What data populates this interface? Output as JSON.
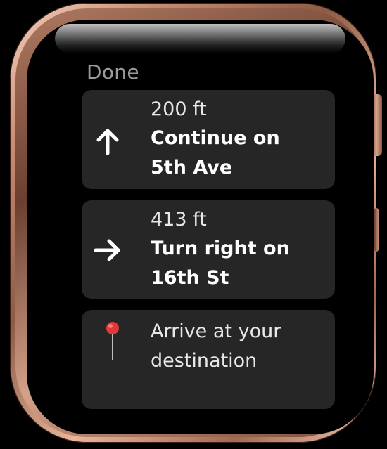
{
  "header": {
    "done_label": "Done"
  },
  "steps": [
    {
      "distance": "200 ft",
      "instruction_line1": "Continue on",
      "instruction_line2": "5th Ave",
      "icon": "arrow-up-icon"
    },
    {
      "distance": "413 ft",
      "instruction_line1": "Turn right on",
      "instruction_line2": "16th St",
      "icon": "arrow-right-icon"
    },
    {
      "line1": "Arrive at your",
      "line2": "destination",
      "icon": "map-pin-icon"
    }
  ],
  "colors": {
    "card_background": "#262626",
    "done_text": "#9a9a9a",
    "pin_red": "#e0393a",
    "case_rose_gold": "#d9a38a"
  }
}
